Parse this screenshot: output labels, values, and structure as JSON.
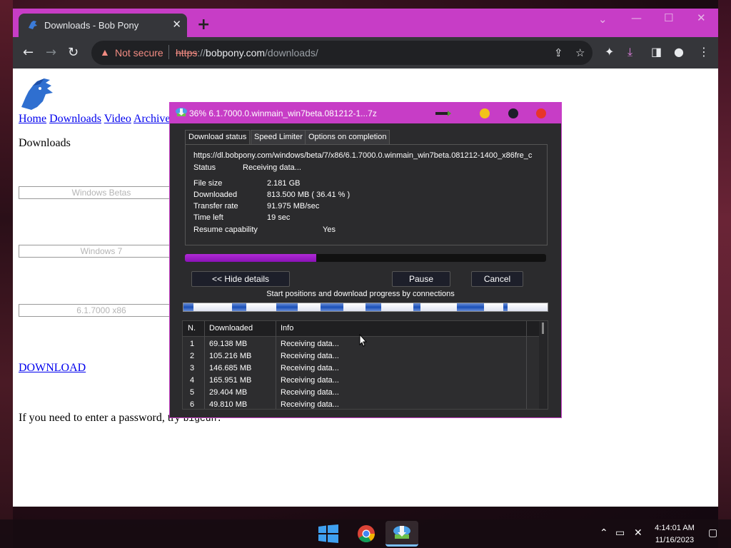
{
  "browser": {
    "tab": {
      "title": "Downloads - Bob Pony"
    },
    "new_tab": "+",
    "window_controls": {
      "dropdown": "⌄",
      "minimize": "—",
      "maximize": "☐",
      "close": "✕"
    },
    "omnibox": {
      "security_label": "Not secure",
      "url_scheme": "https",
      "url_sep": "://",
      "url_host": "bobpony.com",
      "url_path": "/downloads/"
    },
    "accent_color": "#c73dc6"
  },
  "page": {
    "nav_links": [
      "Home",
      "Downloads",
      "Video",
      "Archive"
    ],
    "heading": "Downloads",
    "selects": [
      "Windows Betas",
      "Windows 7",
      "6.1.7000 x86"
    ],
    "download_link": "DOWNLOAD",
    "password_text": "If you need to enter a password, try ",
    "password_code": "bigcun."
  },
  "idm": {
    "title": "36% 6.1.7000.0.winmain_win7beta.081212-1...7z",
    "tabs": [
      "Download status",
      "Speed Limiter",
      "Options on completion"
    ],
    "url": "https://dl.bobpony.com/windows/beta/7/x86/6.1.7000.0.winmain_win7beta.081212-1400_x86fre_c",
    "status_label": "Status",
    "status_value": "Receiving data...",
    "file_size_label": "File size",
    "file_size_value": "2.181  GB",
    "downloaded_label": "Downloaded",
    "downloaded_value": "813.500  MB  ( 36.41 % )",
    "transfer_rate_label": "Transfer rate",
    "transfer_rate_value": "91.975  MB/sec",
    "time_left_label": "Time left",
    "time_left_value": "19 sec",
    "resume_label": "Resume capability",
    "resume_value": "Yes",
    "progress_fraction": 0.3641,
    "buttons": {
      "hide_details": "<< Hide details",
      "pause": "Pause",
      "cancel": "Cancel"
    },
    "connections_label": "Start positions and download progress by connections",
    "table": {
      "headers": [
        "N.",
        "Downloaded",
        "Info"
      ],
      "rows": [
        {
          "n": "1",
          "downloaded": "69.138  MB",
          "info": "Receiving data..."
        },
        {
          "n": "2",
          "downloaded": "105.216  MB",
          "info": "Receiving data..."
        },
        {
          "n": "3",
          "downloaded": "146.685  MB",
          "info": "Receiving data..."
        },
        {
          "n": "4",
          "downloaded": "165.951  MB",
          "info": "Receiving data..."
        },
        {
          "n": "5",
          "downloaded": "29.404  MB",
          "info": "Receiving data..."
        },
        {
          "n": "6",
          "downloaded": "49.810  MB",
          "info": "Receiving data..."
        }
      ]
    }
  },
  "taskbar": {
    "time": "4:14:01 AM",
    "date": "11/16/2023"
  }
}
